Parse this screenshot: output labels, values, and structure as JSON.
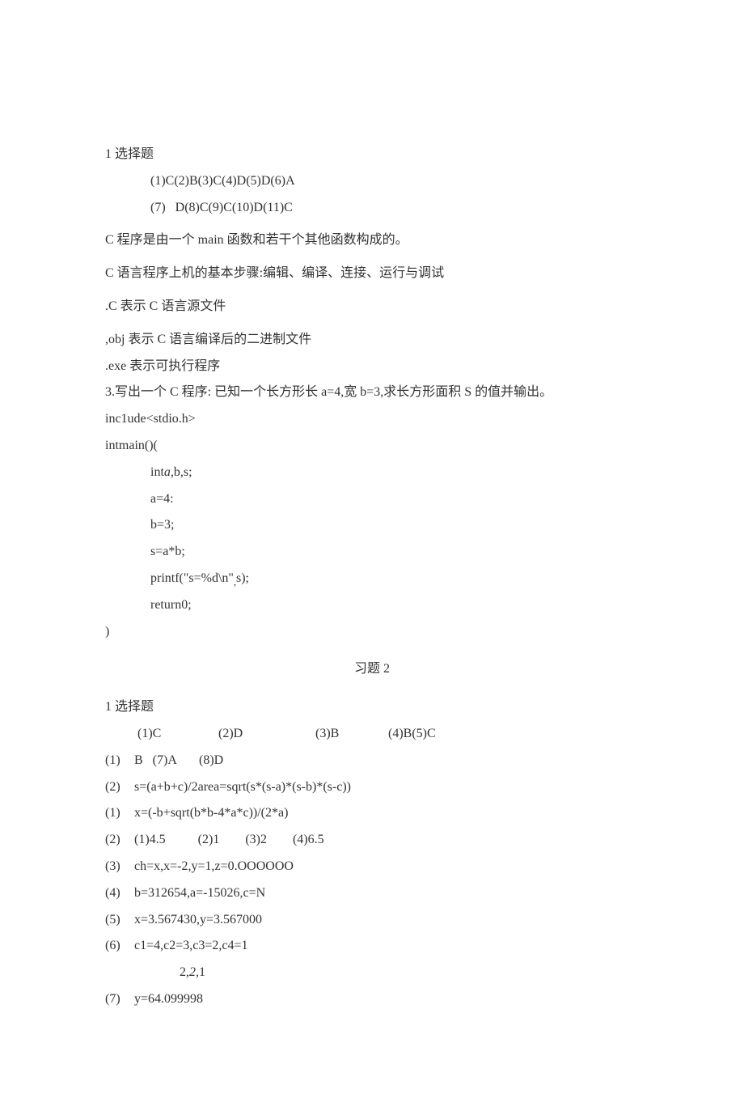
{
  "section1": {
    "title": "1 选择题",
    "answers_line1": "(1)C(2)B(3)C(4)D(5)D(6)A",
    "answers_line2": "(7)   D(8)C(9)C(10)D(11)C",
    "p1": "C 程序是由一个 main 函数和若干个其他函数构成的。",
    "p2": "C 语言程序上机的基本步骤:编辑、编译、连接、运行与调试",
    "p3": ".C 表示 C 语言源文件",
    "p4": ",obj 表示 C 语言编译后的二进制文件",
    "p5": ".exe 表示可执行程序",
    "q3_prefix": "3.写出一个 C 程序:  已知一个长方形长 a=4,宽 b=3,求长方形面积 S 的值并输出。inc1ude<stdio.h>",
    "code": {
      "l1": "intmain()(",
      "l2_a": "int",
      "l2_b": "a,",
      "l2_c": "b,s;",
      "l3": "a=4:",
      "l4": "b=3;",
      "l5": "s=a*b;",
      "l6_a": "printf(\"s=%d\\n\"",
      "l6_b": ",",
      "l6_c": "s);",
      "l7": "return0;",
      "l8": ")"
    }
  },
  "section2_title": "习题 2",
  "section2": {
    "title": "1 选择题",
    "opts": {
      "c": "(1)C",
      "d": "(2)D",
      "b": "(3)B",
      "bc": "(4)B(5)C"
    },
    "lines": {
      "l1_num": "(1)",
      "l1_txt": "B   (7)A       (8)D",
      "l2_num": "(2)",
      "l2_txt": "s=(a+b+c)/2area=sqrt(s*(s-a)*(s-b)*(s-c))",
      "l3_num": "(1)",
      "l3_txt": "x=(-b+sqrt(b*b-4*a*c))/(2*a)",
      "l4_num": "(2)",
      "l4_txt": "(1)4.5          (2)1        (3)2        (4)6.5",
      "l5_num": "(3)",
      "l5_txt": "ch=x,x=-2,y=1,z=0.OOOOOO",
      "l6_num": "(4)",
      "l6_txt": "b=312654,a=-15026,c=N",
      "l7_num": "(5)",
      "l7_txt": "x=3.567430,y=3.567000",
      "l8_num": "(6)",
      "l8_txt": "c1=4,c2=3,c3=2,c4=1",
      "l9_a": "2,",
      "l9_b": "2,",
      "l9_c": "1",
      "l10_num": "(7)",
      "l10_txt": "y=64.099998"
    }
  }
}
